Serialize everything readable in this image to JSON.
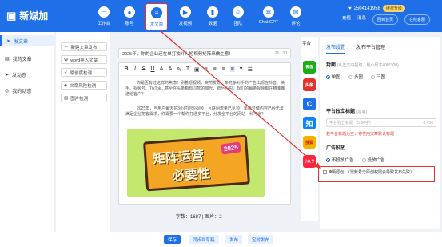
{
  "app": {
    "name": "新媒加"
  },
  "nav": [
    {
      "label": "工作台",
      "icon": "monitor-icon"
    },
    {
      "label": "账号",
      "icon": "user-icon"
    },
    {
      "label": "发文章",
      "icon": "document-icon"
    },
    {
      "label": "发视频",
      "icon": "video-icon"
    },
    {
      "label": "数据",
      "icon": "chart-icon"
    },
    {
      "label": "团队",
      "icon": "team-icon"
    },
    {
      "label": "Chat GPT",
      "icon": "chatgpt-icon"
    },
    {
      "label": "评论",
      "icon": "comment-icon"
    }
  ],
  "user": {
    "id": "2504141958",
    "vip": "续费升级",
    "actions": [
      "充值",
      "消息"
    ],
    "btn1": "回到首页",
    "btn2": "在线客服"
  },
  "sidebar": [
    {
      "label": "发文章"
    },
    {
      "label": "我的文章"
    },
    {
      "label": "发动态"
    },
    {
      "label": "我的动态"
    }
  ],
  "subpanel": [
    {
      "label": "新建文章发布"
    },
    {
      "label": "word导入文章"
    },
    {
      "label": "原创度检测"
    },
    {
      "label": "文章风险检测"
    },
    {
      "label": "图片检测"
    }
  ],
  "editor": {
    "title": "2025年，你的企业还在单打独斗？短视频矩阵来做生意！",
    "title_count": "26 / 30",
    "p1": "你是否有过这样的焦虑？刷着短视频，突然发现一条竞争对手的广告出现在抖音、快手、视频号、TikTok…甚至在头条都有同款的曝光，费尽心思，现们的每条视频都在精准推送给客户？",
    "p2": "2025年，当用户每天花3小时刷短视频，互联网流量已见顶，单账号做内容已经无法满足企业拓客需求，你需要一个帮你打通多平台，分发全平台的网站—科可米？",
    "image_line1": "矩阵运营",
    "image_line2": "必要性",
    "image_year": "2025",
    "word_count": "字数：1687 | 图片：2"
  },
  "bottom": {
    "save": "保存",
    "sync": "同步到草稿",
    "publish": "发布",
    "timed": "定时发布"
  },
  "platforms": [
    "平台",
    "微信",
    "头条",
    "C",
    "知",
    "搜狐",
    "小红书"
  ],
  "right": {
    "tab1": "发布设置",
    "tab2": "发布平台管理",
    "cover_label": "封面",
    "cover_hint": "(从正文中提取，最小尺寸400*300)",
    "cover_opts": [
      "单图",
      "多图",
      "三图"
    ],
    "title_label": "平台独立标题",
    "title_hint": "(选填)",
    "title_placeholder": "平台独立标题（5-30字）",
    "title_count": "0 / 50",
    "title_warn": "若平台标题为空，将使用文章默认标题",
    "ad_label": "广告投放",
    "ad_opts": [
      "不投放广告",
      "投放广告"
    ],
    "declare_label": "声明原创",
    "declare_text": "（需账号无原创权限会导致发布失败）"
  },
  "colors": {
    "brand": "#1e6fe8",
    "highlight": "#e5322d"
  }
}
